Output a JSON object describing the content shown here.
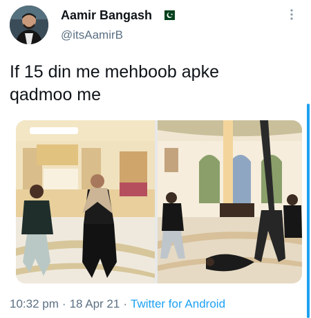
{
  "tweet": {
    "author": {
      "display_name": "Aamir Bangash",
      "handle": "@itsAamirB",
      "flag_icon": "pakistan-flag-icon",
      "flag_colors": {
        "green": "#01411c",
        "white": "#ffffff"
      }
    },
    "text": "If 15 din me mehboob apke\nqadmoo me",
    "media": [
      {
        "type": "photo",
        "description_icon": "tv-show-photo-left"
      },
      {
        "type": "photo",
        "description_icon": "tv-show-photo-right"
      }
    ],
    "meta": {
      "time": "10:32 pm",
      "date": "18 Apr 21",
      "source": "Twitter for Android",
      "separator": "·"
    }
  },
  "colors": {
    "text_primary": "#0f1419",
    "text_secondary": "#5b7083",
    "accent": "#1da1f2"
  }
}
